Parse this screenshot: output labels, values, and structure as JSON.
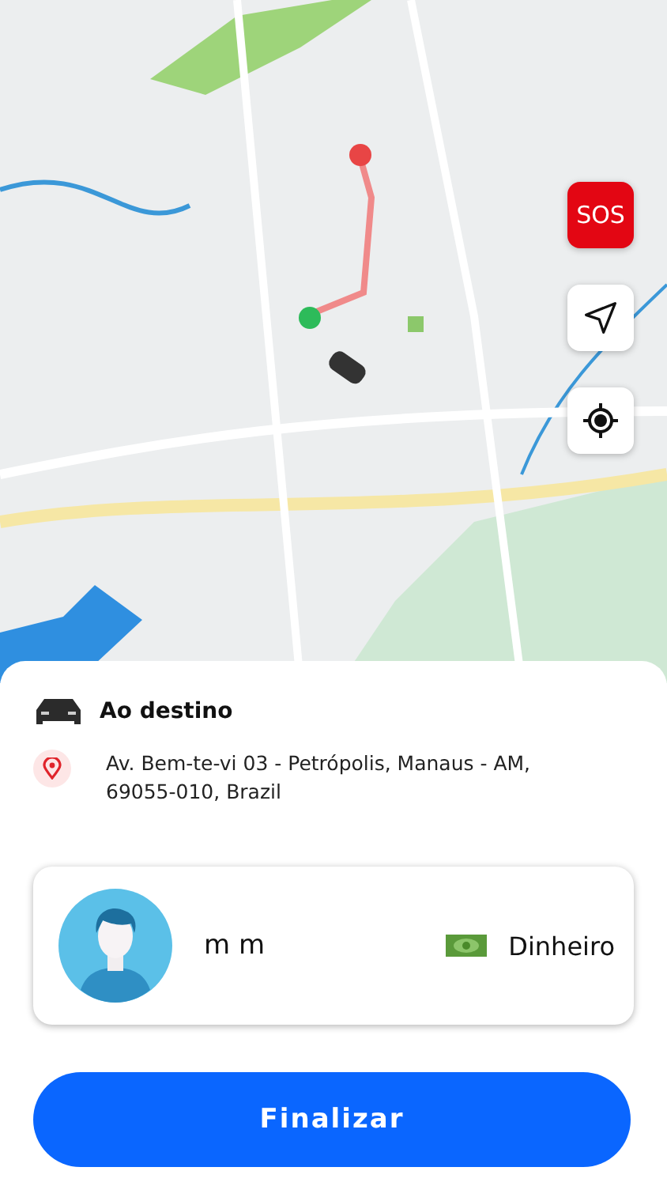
{
  "map_controls": [
    {
      "kind": "sos",
      "label": "SOS"
    },
    {
      "kind": "navigate"
    },
    {
      "kind": "locate"
    }
  ],
  "trip": {
    "title": "Ao destino",
    "address": "Av. Bem-te-vi 03 - Petrópolis, Manaus - AM, 69055-010, Brazil"
  },
  "passenger": {
    "name": "m m",
    "payment": "Dinheiro"
  },
  "button": "Finalizar"
}
